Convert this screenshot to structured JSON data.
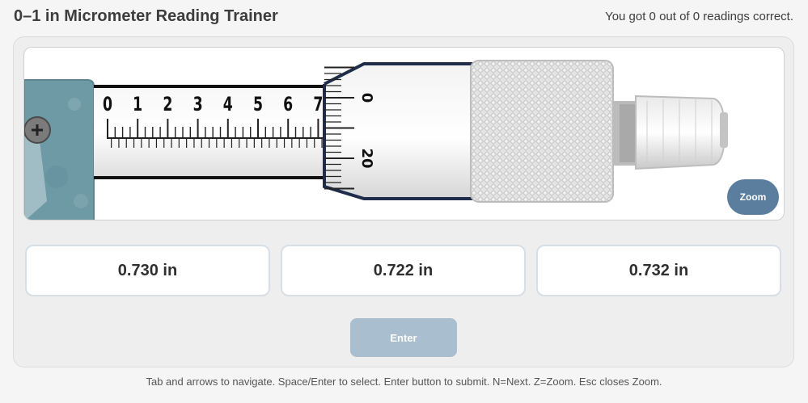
{
  "header": {
    "title": "0–1 in Micrometer Reading Trainer",
    "score": "You got 0 out of 0 readings correct."
  },
  "micrometer": {
    "sleeve_numbers": [
      "0",
      "1",
      "2",
      "3",
      "4",
      "5",
      "6",
      "7"
    ],
    "thimble_numbers": [
      "0",
      "20"
    ],
    "colors": {
      "frame": "#6e9aa6",
      "thimble_outline": "#1f2d4a",
      "knurl": "#d9d9d9"
    }
  },
  "zoom": {
    "label": "Zoom"
  },
  "options": [
    {
      "label": "0.730 in"
    },
    {
      "label": "0.722 in"
    },
    {
      "label": "0.732 in"
    }
  ],
  "enter": {
    "label": "Enter",
    "disabled": true
  },
  "help": "Tab and arrows to navigate. Space/Enter to select. Enter button to submit. N=Next. Z=Zoom. Esc closes Zoom."
}
